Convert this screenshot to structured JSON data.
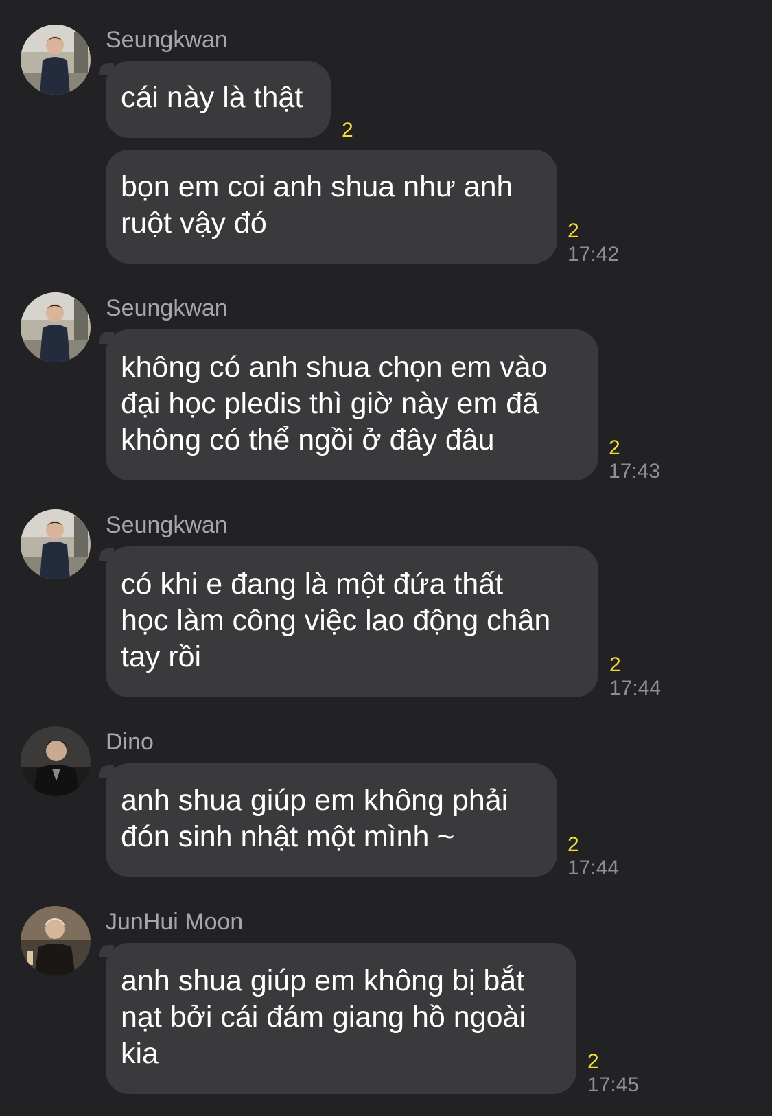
{
  "messages": [
    {
      "sender": "Seungkwan",
      "text": "cái này là thật",
      "unread": "2",
      "time": ""
    },
    {
      "sender": "",
      "text": "bọn em coi anh shua như anh\nruột vậy đó",
      "unread": "2",
      "time": "17:42"
    },
    {
      "sender": "Seungkwan",
      "text": "không có anh shua chọn em vào\nđại học pledis thì giờ này em đã\nkhông có thể ngồi ở đây đâu",
      "unread": "2",
      "time": "17:43"
    },
    {
      "sender": "Seungkwan",
      "text": "có khi e đang là một đứa thất\nhọc làm công việc lao động chân\ntay rồi",
      "unread": "2",
      "time": "17:44"
    },
    {
      "sender": "Dino",
      "text": "anh shua giúp em không phải\nđón sinh nhật một mình ~",
      "unread": "2",
      "time": "17:44"
    },
    {
      "sender": "JunHui Moon",
      "text": "anh shua giúp em không bị bắt\nnạt bởi cái đám giang hồ ngoài\nkia",
      "unread": "2",
      "time": "17:45"
    }
  ],
  "colors": {
    "background": "#222225",
    "bubble": "#3a3a3d",
    "unread": "#f5dc36",
    "time": "#8e8e93",
    "sender": "#a7a7ab"
  },
  "icons": {
    "seungkwan_avatar": "avatar-photo-seungkwan",
    "dino_avatar": "avatar-photo-dino",
    "junhui_avatar": "avatar-photo-junhui"
  }
}
